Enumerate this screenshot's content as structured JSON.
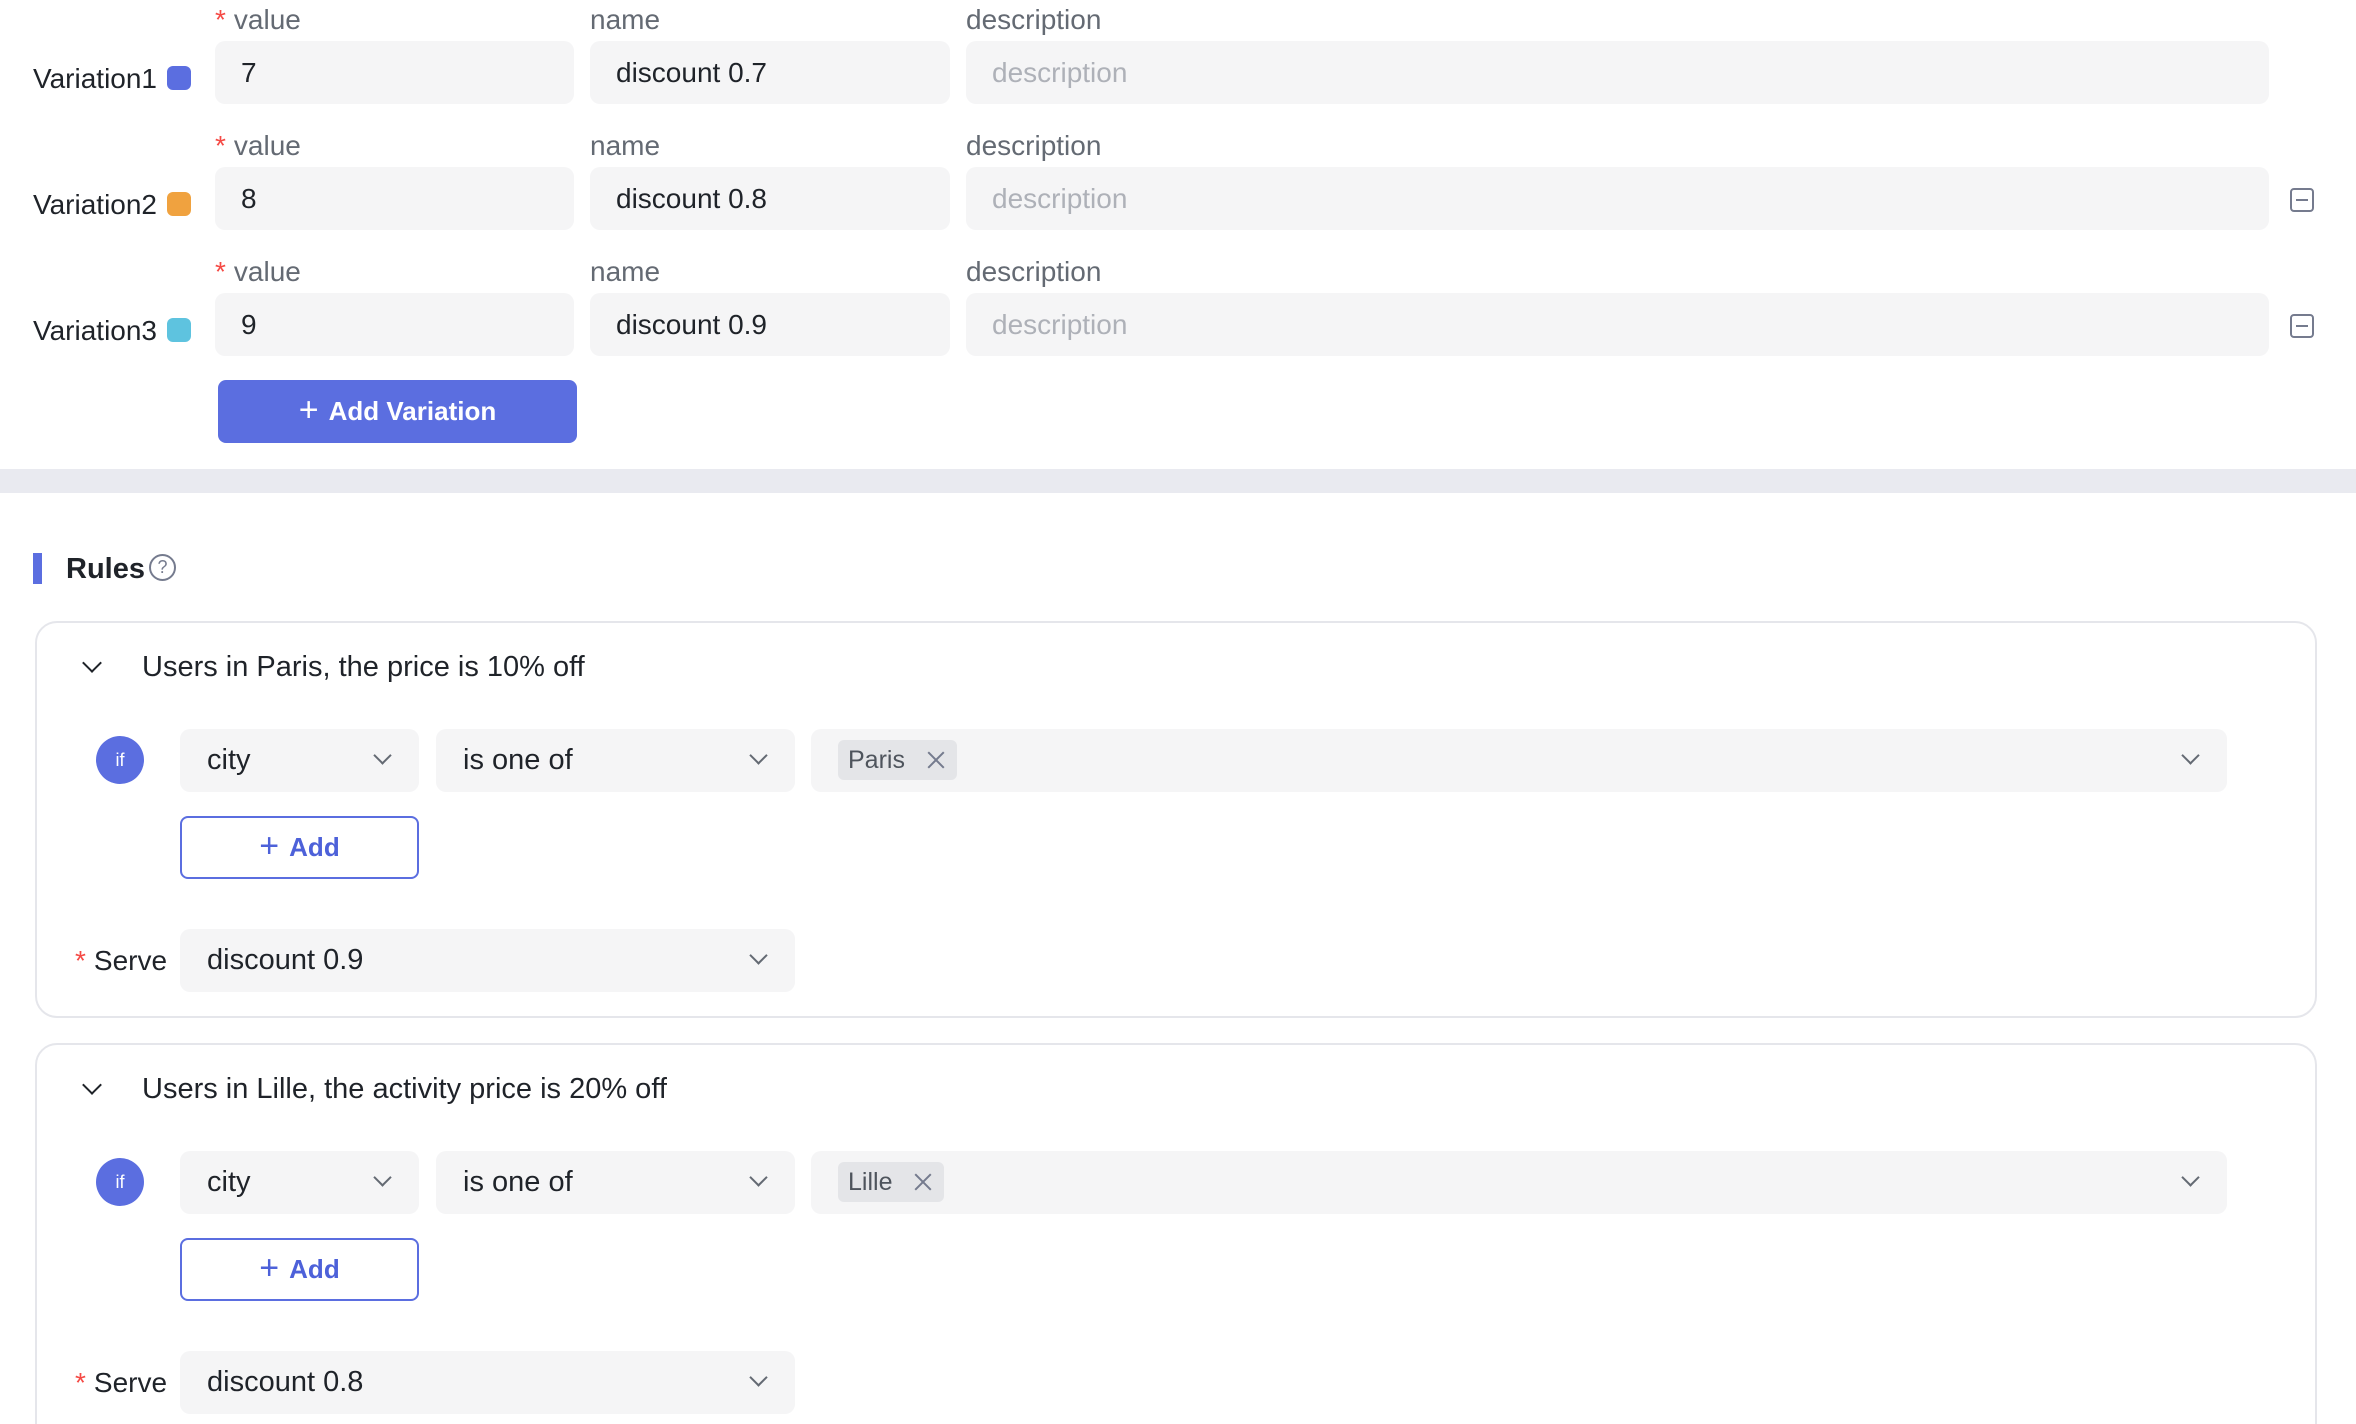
{
  "variations": {
    "field_labels": {
      "value": "value",
      "name": "name",
      "description": "description"
    },
    "required_mark": "*",
    "items": [
      {
        "label": "Variation1",
        "color": "#5b6ee0",
        "value": "7",
        "name": "discount 0.7",
        "description": "",
        "description_placeholder": "description",
        "removable": false
      },
      {
        "label": "Variation2",
        "color": "#f0a23f",
        "value": "8",
        "name": "discount 0.8",
        "description": "",
        "description_placeholder": "description",
        "removable": true
      },
      {
        "label": "Variation3",
        "color": "#5ec3df",
        "value": "9",
        "name": "discount 0.9",
        "description": "",
        "description_placeholder": "description",
        "removable": true
      }
    ],
    "add_button": {
      "icon": "plus-icon",
      "label": "Add Variation"
    }
  },
  "rules": {
    "title": "Rules",
    "help_icon": "question-circle-icon",
    "accent_color": "#5b6ee0",
    "items": [
      {
        "title": "Users in Paris, the price is 10% off",
        "condition": {
          "if_label": "if",
          "attribute": "city",
          "operator": "is one of",
          "values": [
            "Paris"
          ]
        },
        "add_label": "Add",
        "serve_label": "Serve",
        "serve_value": "discount 0.9"
      },
      {
        "title": "Users in Lille, the activity price is 20% off",
        "condition": {
          "if_label": "if",
          "attribute": "city",
          "operator": "is one of",
          "values": [
            "Lille"
          ]
        },
        "add_label": "Add",
        "serve_label": "Serve",
        "serve_value": "discount 0.8"
      }
    ]
  }
}
